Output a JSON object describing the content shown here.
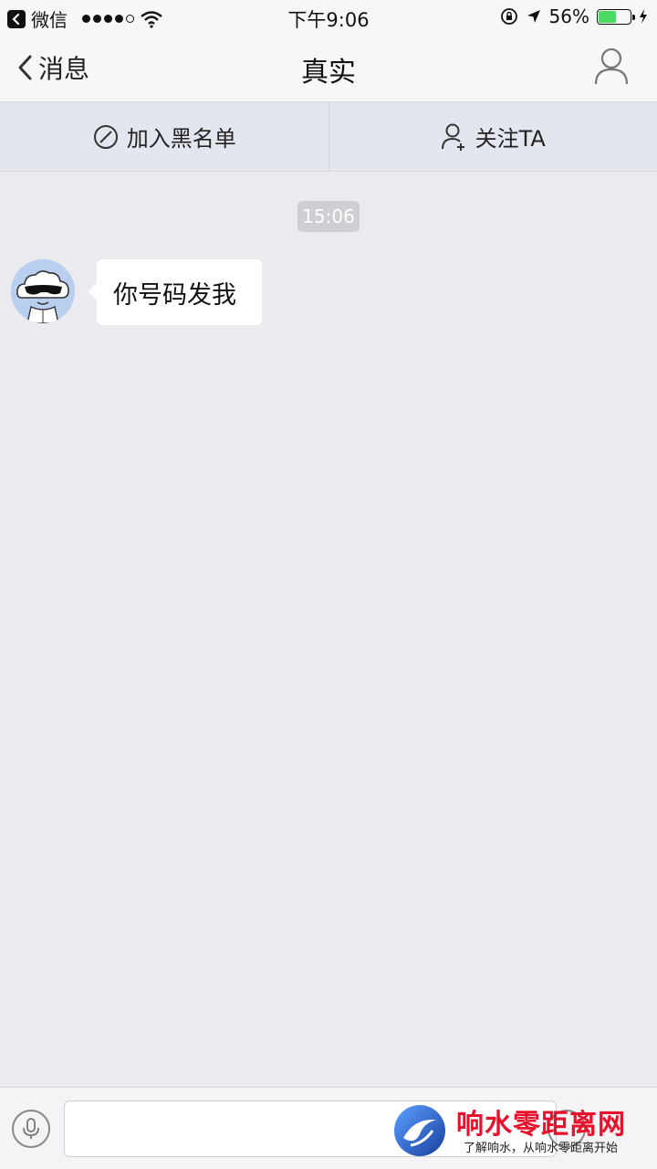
{
  "status_bar": {
    "back_app": "微信",
    "time": "下午9:06",
    "battery_percent": "56%",
    "battery_level": 0.56,
    "signal_dots_filled": 4,
    "signal_dots_total": 5
  },
  "nav": {
    "back_label": "消息",
    "title": "真实"
  },
  "actions": {
    "blacklist_label": "加入黑名单",
    "follow_label": "关注TA"
  },
  "chat": {
    "timestamp": "15:06",
    "messages": [
      {
        "text": "你号码发我"
      }
    ]
  },
  "input": {
    "value": "",
    "placeholder": ""
  },
  "watermark": {
    "title": "响水零距离网",
    "subtitle": "了解响水，从响水零距离开始"
  },
  "colors": {
    "background": "#ebebef",
    "action_bar": "#e3e5ef",
    "battery_fill": "#4cd964",
    "watermark_red": "#e8102a"
  }
}
